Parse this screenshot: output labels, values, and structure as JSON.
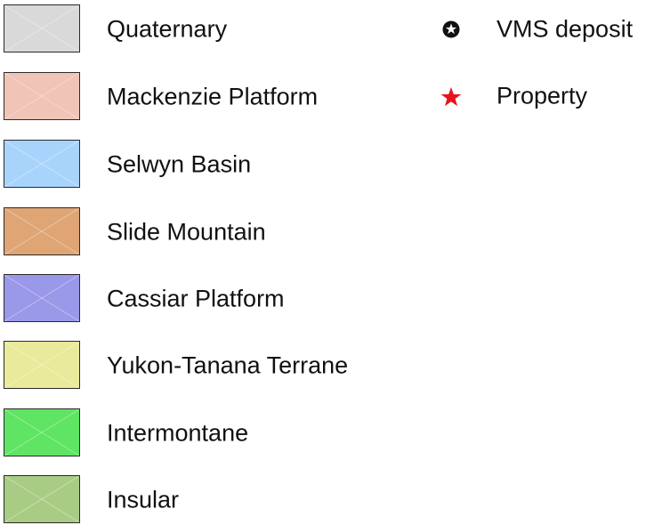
{
  "legend": {
    "units": [
      {
        "label": "Quaternary",
        "color": "#d9d9d9"
      },
      {
        "label": "Mackenzie Platform",
        "color": "#f0c4b6"
      },
      {
        "label": "Selwyn Basin",
        "color": "#a8d4fc"
      },
      {
        "label": "Slide Mountain",
        "color": "#dfa574"
      },
      {
        "label": "Cassiar Platform",
        "color": "#9a98e8"
      },
      {
        "label": "Yukon-Tanana Terrane",
        "color": "#eaea9c"
      },
      {
        "label": "Intermontane",
        "color": "#5fe463"
      },
      {
        "label": "Insular",
        "color": "#a8cc84"
      }
    ],
    "symbols": [
      {
        "label": "VMS deposit",
        "icon": "circled-star-icon",
        "color": "#111111"
      },
      {
        "label": "Property",
        "icon": "red-star-icon",
        "color": "#e8141c"
      }
    ]
  }
}
